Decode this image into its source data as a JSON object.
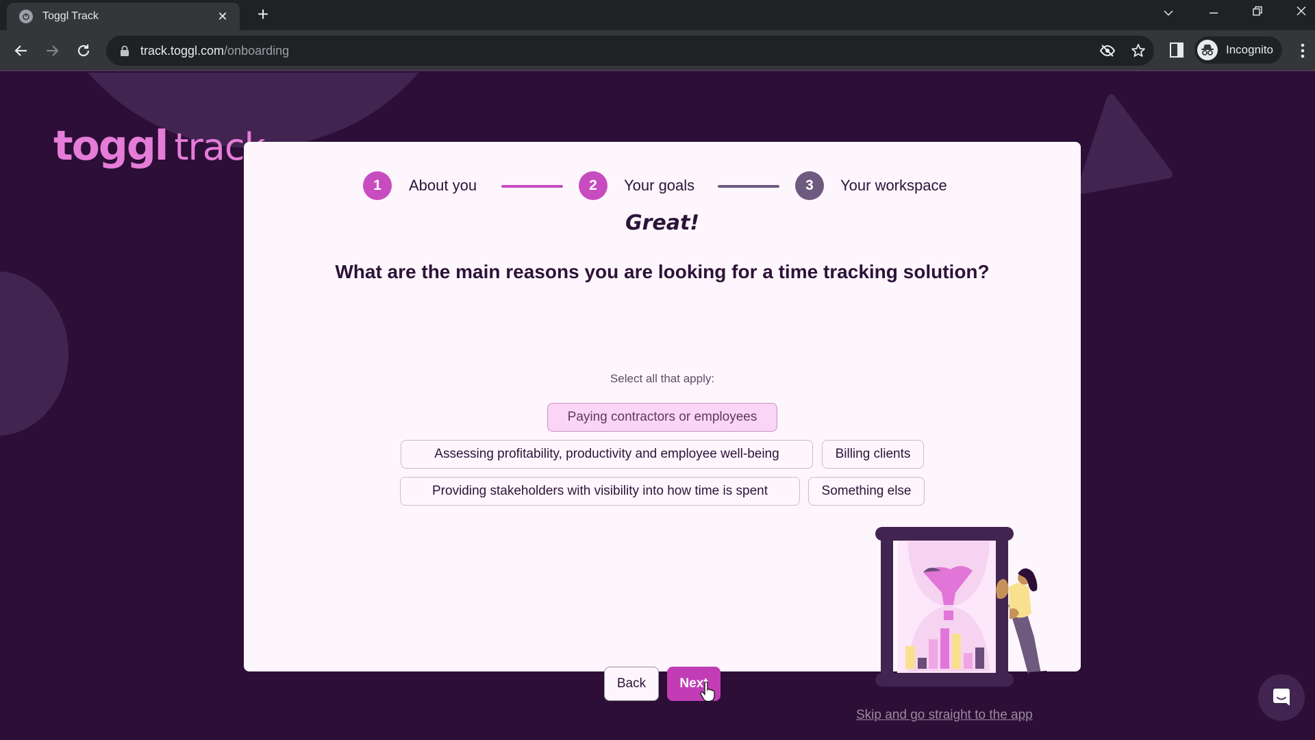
{
  "browser": {
    "tab_title": "Toggl Track",
    "url_host": "track.toggl.com",
    "url_path": "/onboarding",
    "profile_label": "Incognito"
  },
  "logo": {
    "brand": "toggl",
    "product": "track"
  },
  "steps": [
    {
      "number": "1",
      "label": "About you",
      "state": "completed"
    },
    {
      "number": "2",
      "label": "Your goals",
      "state": "active"
    },
    {
      "number": "3",
      "label": "Your workspace",
      "state": "upcoming"
    }
  ],
  "onboarding": {
    "exclamation": "Great!",
    "question": "What are the main reasons you are looking for a time tracking solution?",
    "hint": "Select all that apply:",
    "options": [
      {
        "label": "Paying contractors or employees",
        "selected": true
      },
      {
        "label": "Assessing profitability, productivity and employee well-being",
        "selected": false
      },
      {
        "label": "Billing clients",
        "selected": false
      },
      {
        "label": "Providing stakeholders with visibility into how time is spent",
        "selected": false
      },
      {
        "label": "Something else",
        "selected": false
      }
    ],
    "back_label": "Back",
    "next_label": "Next",
    "skip_label": "Skip and go straight to the app"
  },
  "colors": {
    "page_bg": "#2c0e37",
    "accent": "#c23cb6",
    "step_active": "#c74cbf",
    "step_inactive": "#6e5a7e",
    "card_bg": "#fef6fd",
    "selected_chip_bg": "#fad5f5"
  }
}
